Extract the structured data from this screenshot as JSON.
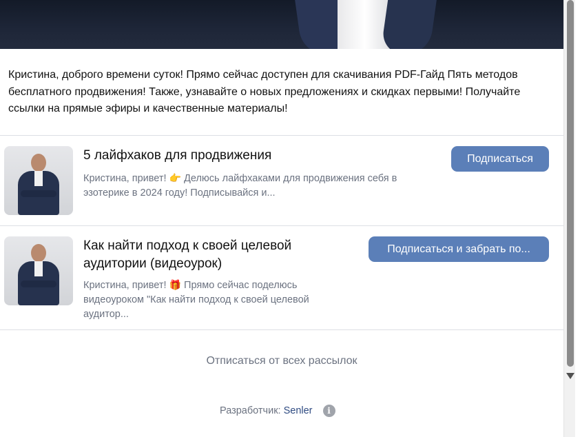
{
  "intro": {
    "text": "Кристина, доброго времени суток! Прямо сейчас доступен для скачивания PDF-Гайд Пять методов бесплатного продвижения! Также, узнавайте о новых предложениях и скидках первыми! Получайте ссылки на прямые эфиры и качественные материалы!"
  },
  "items": [
    {
      "title": "5 лайфхаков для продвижения",
      "desc_before": "Кристина, привет!",
      "emoji": "👉",
      "desc_after": "Делюсь лайфхаками для продвижения себя в эзотерике в 2024 году! Подписывайся и...",
      "button": "Подписаться"
    },
    {
      "title": "Как найти подход к своей целевой аудитории (видеоурок)",
      "desc_before": "Кристина, привет!",
      "emoji": "🎁",
      "desc_after": "Прямо сейчас поделюсь видеоуроком \"Как найти подход к своей целевой аудитор...",
      "button": "Подписаться и забрать по..."
    }
  ],
  "unsubscribe": "Отписаться от всех рассылок",
  "footer": {
    "label": "Разработчик:",
    "developer": "Senler",
    "info_icon": "i"
  },
  "colors": {
    "button": "#5b7fb8",
    "muted_text": "#6b7280",
    "link": "#2f4b82"
  }
}
